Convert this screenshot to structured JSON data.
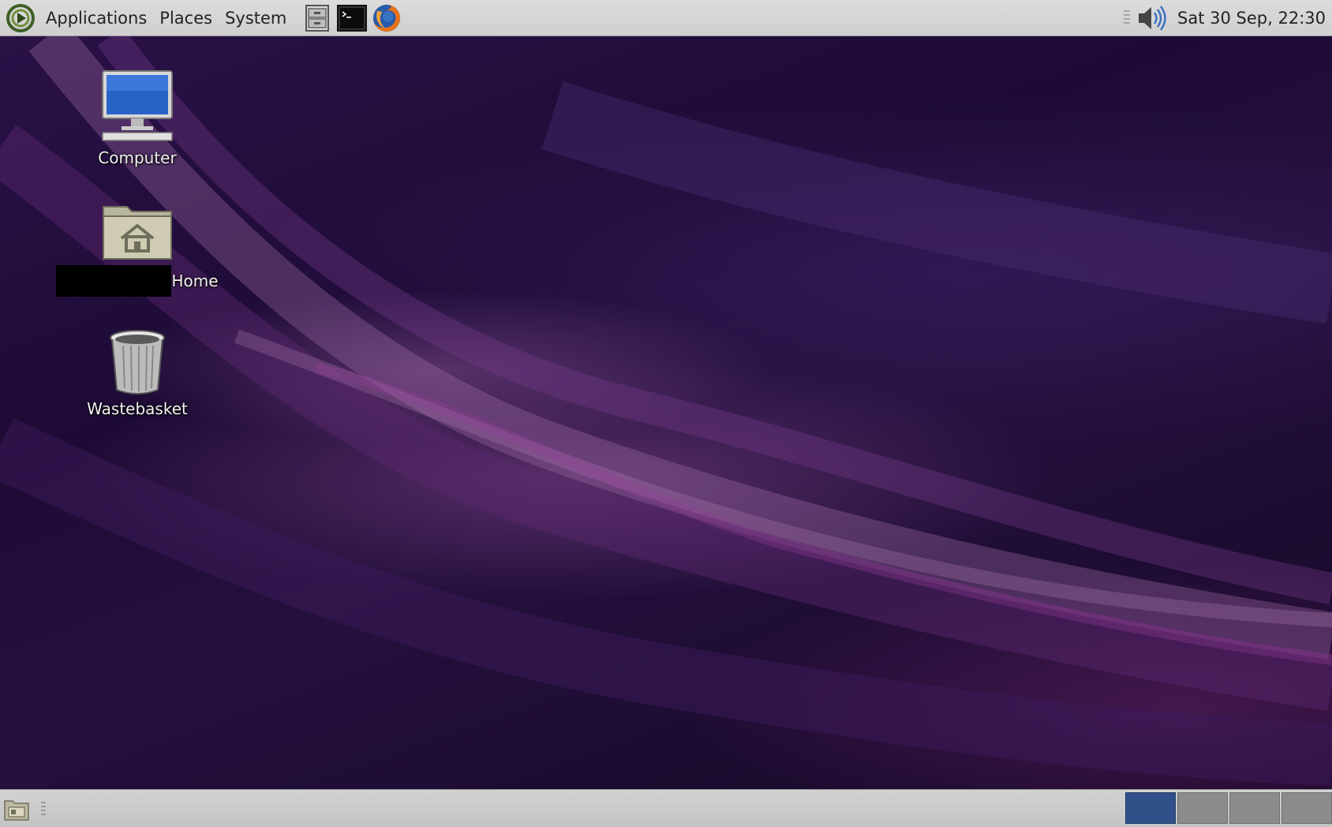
{
  "top_panel": {
    "menus": [
      {
        "label": "Applications"
      },
      {
        "label": "Places"
      },
      {
        "label": "System"
      }
    ],
    "launchers": [
      {
        "icon": "file-manager-icon"
      },
      {
        "icon": "terminal-icon"
      },
      {
        "icon": "firefox-icon"
      }
    ],
    "clock": "Sat 30 Sep, 22:30",
    "volume_icon": "speaker-volume-icon"
  },
  "desktop": {
    "icons": [
      {
        "label": "Computer",
        "icon": "computer-monitor-icon"
      },
      {
        "label": "Home",
        "icon": "home-folder-icon"
      },
      {
        "label": "Wastebasket",
        "icon": "trash-icon"
      }
    ]
  },
  "bottom_panel": {
    "show_desktop_icon": "show-desktop-icon",
    "workspaces": [
      {
        "active": true
      },
      {
        "active": false
      },
      {
        "active": false
      },
      {
        "active": false
      }
    ]
  },
  "colors": {
    "panel": "#d4d4d4",
    "workspace_active": "#2f5089",
    "workspace_inactive": "#8c8c8c",
    "wallpaper_base": "#1d0b35"
  }
}
